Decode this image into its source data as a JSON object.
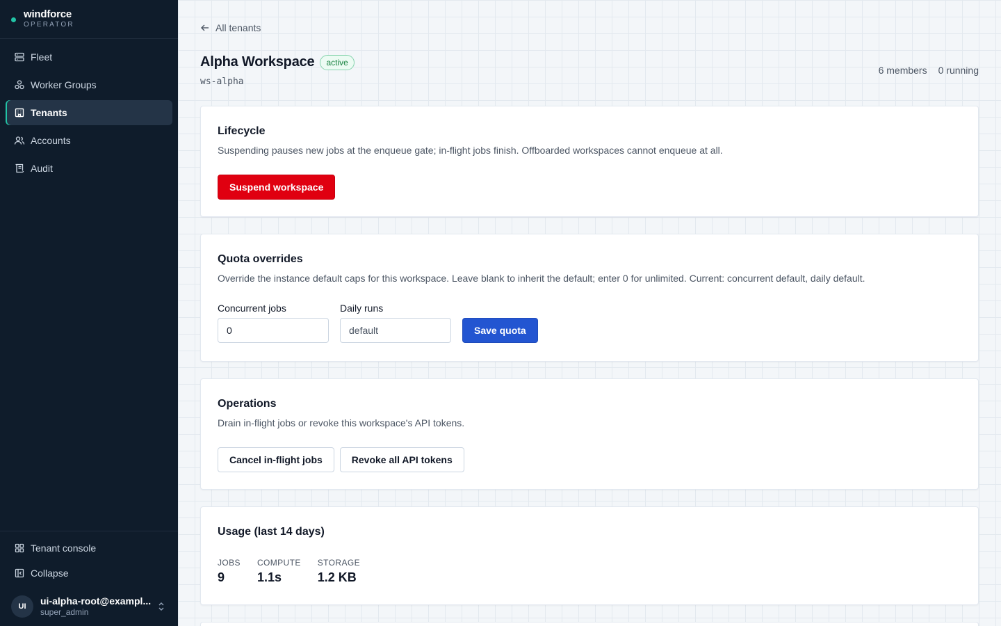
{
  "brand": {
    "name": "windforce",
    "subtitle": "OPERATOR"
  },
  "nav": [
    {
      "label": "Fleet",
      "icon": "server-icon"
    },
    {
      "label": "Worker Groups",
      "icon": "cluster-icon"
    },
    {
      "label": "Tenants",
      "icon": "building-icon",
      "active": true
    },
    {
      "label": "Accounts",
      "icon": "users-icon"
    },
    {
      "label": "Audit",
      "icon": "scroll-icon"
    }
  ],
  "sidebar_bottom": {
    "tenant_console": "Tenant console",
    "collapse": "Collapse",
    "user": {
      "initials": "UI",
      "email": "ui-alpha-root@exampl...",
      "role": "super_admin"
    }
  },
  "header": {
    "back_label": "All tenants",
    "title": "Alpha Workspace",
    "status": "active",
    "slug": "ws-alpha",
    "members": "6 members",
    "running": "0 running"
  },
  "lifecycle": {
    "title": "Lifecycle",
    "description": "Suspending pauses new jobs at the enqueue gate; in-flight jobs finish. Offboarded workspaces cannot enqueue at all.",
    "button": "Suspend workspace"
  },
  "quota": {
    "title": "Quota overrides",
    "description": "Override the instance default caps for this workspace. Leave blank to inherit the default; enter 0 for unlimited. Current: concurrent default, daily default.",
    "concurrent_label": "Concurrent jobs",
    "concurrent_value": "0",
    "daily_label": "Daily runs",
    "daily_placeholder": "default",
    "button": "Save quota"
  },
  "operations": {
    "title": "Operations",
    "description": "Drain in-flight jobs or revoke this workspace's API tokens.",
    "cancel_button": "Cancel in-flight jobs",
    "revoke_button": "Revoke all API tokens"
  },
  "usage": {
    "title": "Usage (last 14 days)",
    "metrics": [
      {
        "label": "JOBS",
        "value": "9"
      },
      {
        "label": "COMPUTE",
        "value": "1.1s"
      },
      {
        "label": "STORAGE",
        "value": "1.2 KB"
      }
    ]
  },
  "colors": {
    "sidebar_bg": "#0f1c2b",
    "accent": "#22c3a6",
    "danger": "#e00010",
    "primary": "#2355d1"
  }
}
